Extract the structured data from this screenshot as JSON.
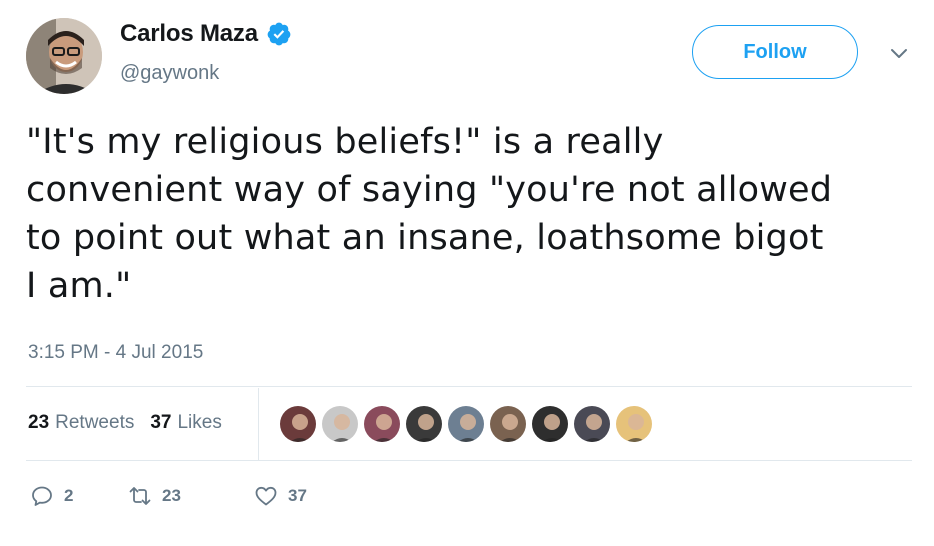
{
  "user": {
    "display_name": "Carlos Maza",
    "handle": "@gaywonk",
    "verified": true,
    "avatar_icon": "profile-photo"
  },
  "header": {
    "follow_label": "Follow",
    "menu_icon": "chevron-down-icon"
  },
  "tweet": {
    "text": "\"It's my religious beliefs!\" is a really\nconvenient way of saying \"you're not allowed\nto point out what an insane, loathsome bigot\nI am.\"",
    "timestamp": "3:15 PM - 4 Jul 2015"
  },
  "stats": {
    "retweets_count": "23",
    "retweets_label": "Retweets",
    "likes_count": "37",
    "likes_label": "Likes"
  },
  "liker_avatars": [
    {
      "color": "#6b3b3b"
    },
    {
      "color": "#c8c8c8"
    },
    {
      "color": "#8a4b5c"
    },
    {
      "color": "#3a3a3a"
    },
    {
      "color": "#6d7f92"
    },
    {
      "color": "#7a6250"
    },
    {
      "color": "#2e2e2e"
    },
    {
      "color": "#4a4a55"
    },
    {
      "color": "#e6c27a"
    }
  ],
  "actions": {
    "reply_count": "2",
    "retweet_count": "23",
    "like_count": "37"
  },
  "colors": {
    "accent": "#1da1f2",
    "text": "#14171a",
    "muted": "#657786",
    "divider": "#e1e8ed"
  }
}
